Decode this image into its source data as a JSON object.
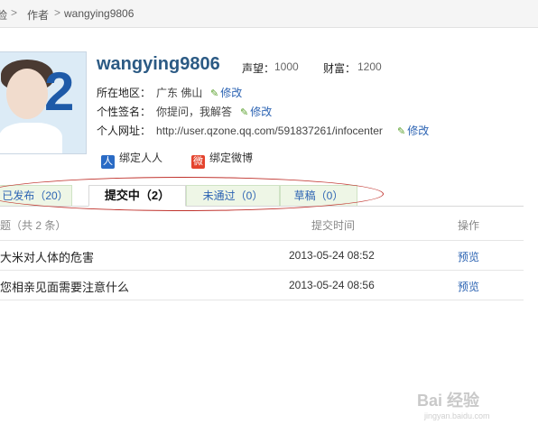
{
  "breadcrumb": {
    "item1": "脸",
    "item2": "作者",
    "item3": "wangying9806",
    "sep": ">"
  },
  "profile": {
    "username": "wangying9806",
    "reputation_label": "声望：",
    "reputation_value": "1000",
    "wealth_label": "财富：",
    "wealth_value": "1200",
    "avatar_text": "2",
    "region_label": "所在地区：",
    "region_value": "广东 佛山",
    "signature_label": "个性签名：",
    "signature_value": "你提问，我解答",
    "website_label": "个人网址：",
    "website_value": "http://user.qzone.qq.com/591837261/infocenter",
    "edit_label": "修改",
    "bind_renren": "绑定人人",
    "bind_weibo": "绑定微博"
  },
  "tabs": [
    {
      "label": "已发布（20）"
    },
    {
      "label": "提交中（2）"
    },
    {
      "label": "未通过（0）"
    },
    {
      "label": "草稿（0）"
    }
  ],
  "table": {
    "headers": {
      "title": "题（共 2 条）",
      "time": "提交时间",
      "action": "操作"
    },
    "rows": [
      {
        "title": "大米对人体的危害",
        "time": "2013-05-24 08:52",
        "action": "预览"
      },
      {
        "title": "您相亲见面需要注意什么",
        "time": "2013-05-24 08:56",
        "action": "预览"
      }
    ]
  },
  "watermark": {
    "brand": "Bai 经验",
    "url": "jingyan.baidu.com"
  },
  "colors": {
    "link": "#2d64b3",
    "username": "#2b5a84",
    "tab_bg": "#eef6e6",
    "annotation": "#c0332d"
  }
}
